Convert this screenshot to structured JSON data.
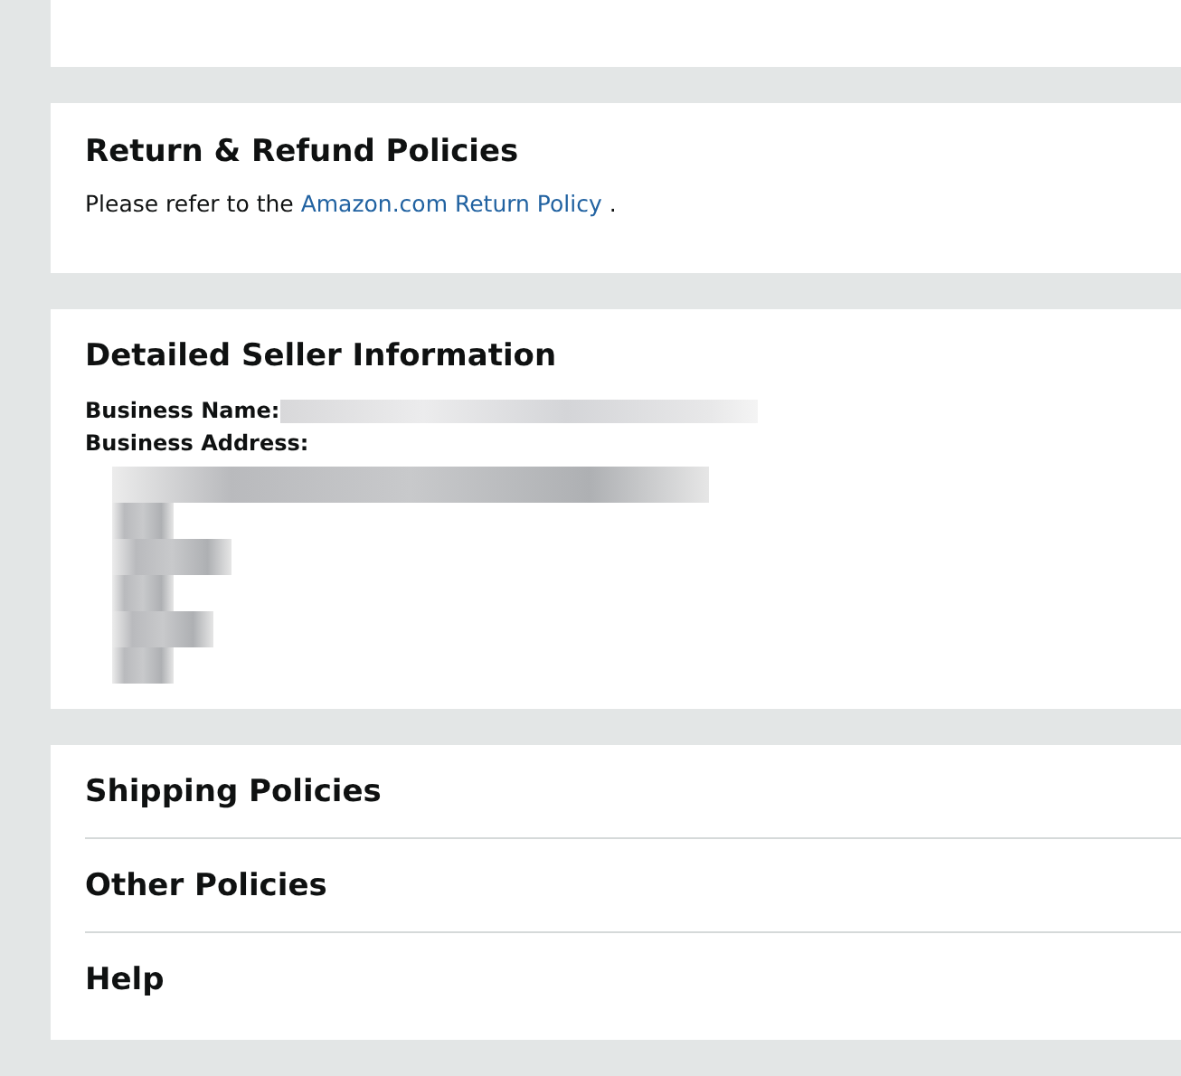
{
  "return_policies": {
    "title": "Return & Refund Policies",
    "text_before": "Please refer to the ",
    "link": "Amazon.com Return Policy",
    "text_after": " ."
  },
  "seller_info": {
    "title": "Detailed Seller Information",
    "name_label": "Business Name:",
    "address_label": "Business Address:"
  },
  "policy_sections": [
    {
      "title": "Shipping Policies"
    },
    {
      "title": "Other Policies"
    },
    {
      "title": "Help"
    }
  ]
}
